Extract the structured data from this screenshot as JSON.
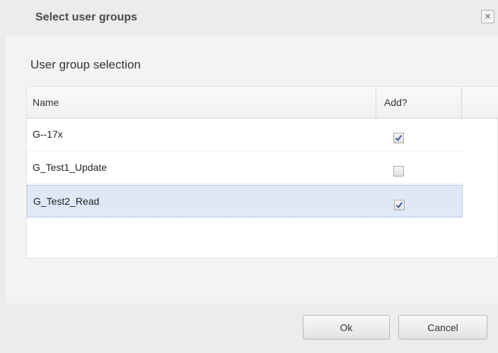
{
  "dialog": {
    "title": "Select user groups",
    "close_label": "×"
  },
  "content": {
    "heading": "User group selection"
  },
  "grid": {
    "columns": {
      "name": "Name",
      "add": "Add?"
    },
    "rows": [
      {
        "name": "G--17x",
        "checked": true,
        "selected": false
      },
      {
        "name": "G_Test1_Update",
        "checked": false,
        "selected": false
      },
      {
        "name": "G_Test2_Read",
        "checked": true,
        "selected": true
      }
    ]
  },
  "buttons": {
    "ok": "Ok",
    "cancel": "Cancel"
  },
  "icons": {
    "close": "close-icon",
    "check": "checkmark-icon"
  },
  "colors": {
    "selected_row": "#dfe8f6",
    "checkmark": "#3b5a9a"
  }
}
